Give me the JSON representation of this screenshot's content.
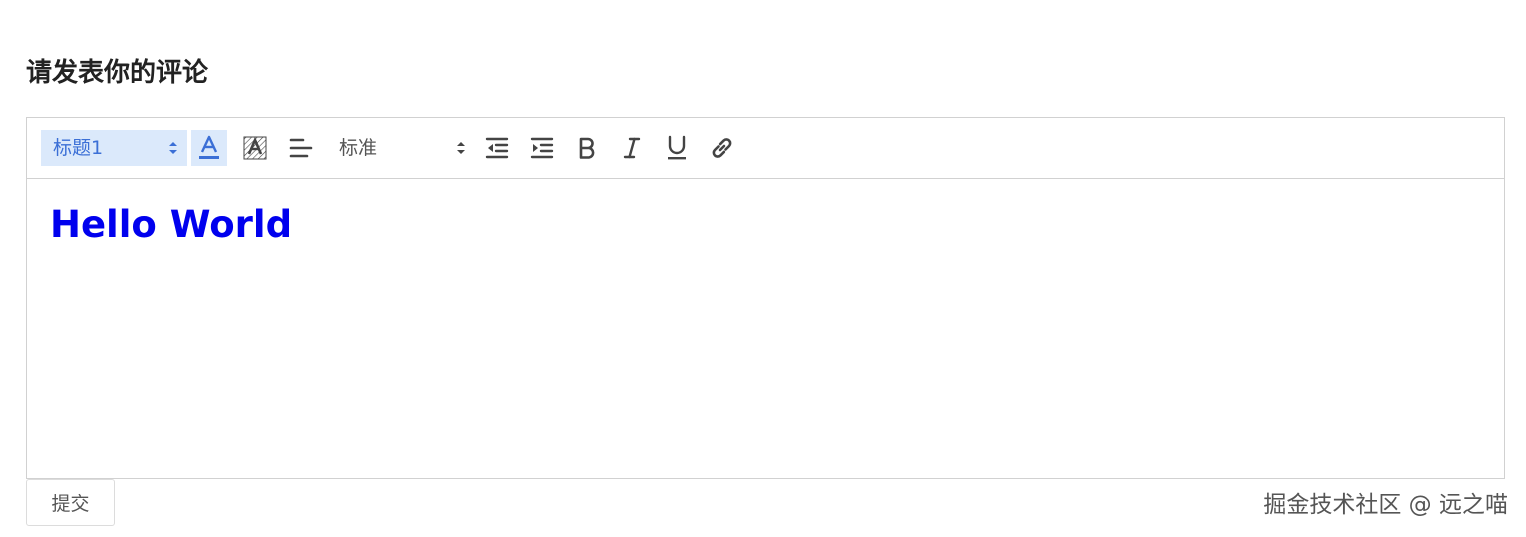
{
  "page": {
    "title": "请发表你的评论",
    "submit_label": "提交",
    "watermark": "掘金技术社区 @ 远之喵"
  },
  "toolbar": {
    "header_select": {
      "value": "标题1"
    },
    "size_select": {
      "value": "标准"
    },
    "icons": {
      "text_color": "text-color-icon",
      "background_color": "background-color-icon",
      "align": "align-left-icon",
      "indent_decrease": "outdent-icon",
      "indent_increase": "indent-icon",
      "bold": "bold-icon",
      "italic": "italic-icon",
      "underline": "underline-icon",
      "link": "link-icon"
    }
  },
  "editor": {
    "content_heading": "Hello World"
  },
  "colors": {
    "active_bg": "#dbe9fb",
    "active_text": "#3b6fd6",
    "heading_text": "#0000ee",
    "icon": "#444444"
  }
}
